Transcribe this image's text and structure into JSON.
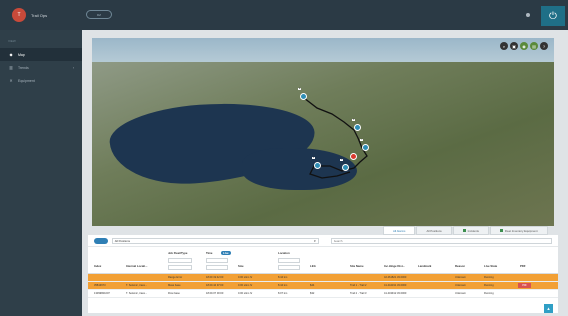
{
  "header": {
    "user_name": "Trail Ops",
    "avatar_initial": "T",
    "logo_text": "DZ",
    "power_glyph": "⏻"
  },
  "sidebar": {
    "section_title": "VIEW",
    "items": [
      {
        "label": "Map",
        "icon": "pin-icon"
      },
      {
        "label": "Trends",
        "icon": "chart-icon"
      },
      {
        "label": "Equipment",
        "icon": "wrench-icon"
      }
    ]
  },
  "map": {
    "tools": [
      "⌕",
      "▣",
      "◉",
      "▤",
      "?"
    ],
    "pins": [
      {
        "label": "A"
      },
      {
        "label": "B"
      },
      {
        "label": "C"
      },
      {
        "label": "D"
      },
      {
        "label": "E"
      },
      {
        "label": "F"
      }
    ]
  },
  "tabs": [
    "All Alarms",
    "All Positions",
    "Incidents",
    "Fleet Inventory Equipment"
  ],
  "filter": {
    "select_value": "All Positions",
    "search_placeholder": "Search"
  },
  "table": {
    "group_headers": {
      "job": "Job Fleet/Type",
      "time": "Time",
      "location": "Location"
    },
    "time_badge": "Live",
    "headers": [
      "Index",
      "Internal Locati...",
      "Size",
      "LEG",
      "Site Name",
      "Inc.Hinge Dist...",
      "Landmark",
      "Reason",
      "Live State",
      "PDF"
    ],
    "rows": [
      {
        "cells": [
          "",
          "",
          "Range Error",
          "18.09 19:42:00",
          "0.00 s/km hr",
          "8.44 km",
          "",
          "",
          "42.461821 33.0000",
          "",
          "Unknown",
          "Running"
        ],
        "pdf": ""
      },
      {
        "cells": [
          "35813673",
          "T. Seismic, trace...",
          "Mass base",
          "18.09.44 97:00",
          "0.00 s/km hr",
          "8.44 km",
          "$44",
          "Trail 1 - Trail 2",
          "41.444191 33.0000",
          "",
          "Unknown",
          "Running"
        ],
        "pdf": "PDF"
      },
      {
        "cells": [
          "13399821007",
          "T. Seismic, trace...",
          "Flow base",
          "18.09.07 00:00",
          "0.00 s/km hr",
          "8.07 km",
          "$32",
          "Trail 2 - Trail 3",
          "41.443912 33.0000",
          "",
          "Unknown",
          "Running"
        ],
        "pdf": ""
      }
    ]
  },
  "colors": {
    "accent": "#2f7fb5",
    "highlight": "#f2a035",
    "sidebar": "#2f3f49"
  }
}
